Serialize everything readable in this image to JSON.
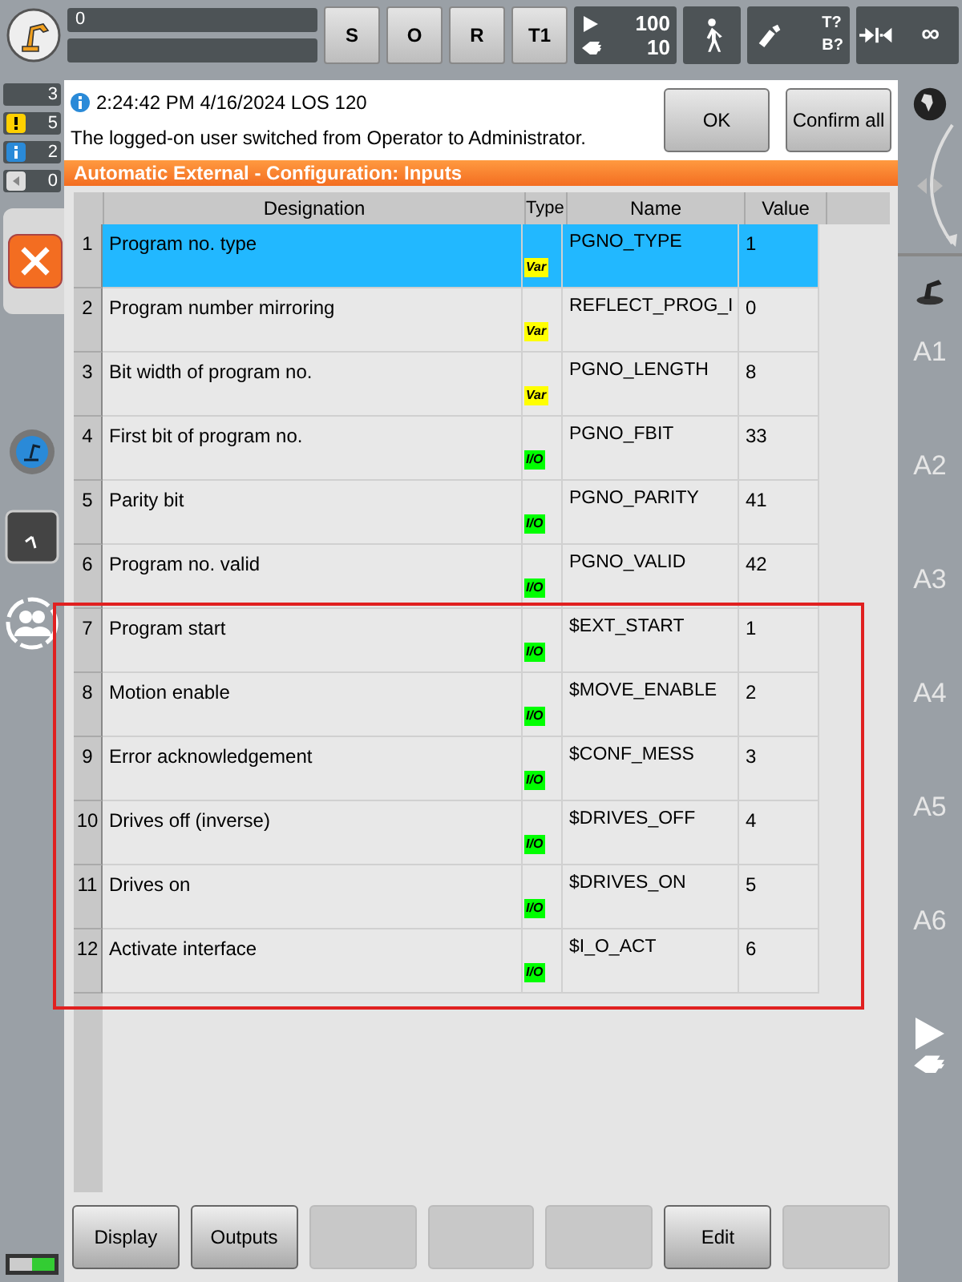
{
  "top_bar": {
    "status_field": "0",
    "mode_buttons": [
      "S",
      "O",
      "R",
      "T1"
    ],
    "override": {
      "program": "100",
      "jog": "10"
    },
    "tool_base": {
      "tool": "T?",
      "base": "B?"
    },
    "run_mode": "∞"
  },
  "left_sidebar": {
    "message_counts": [
      {
        "kind": "ack",
        "count": "3"
      },
      {
        "kind": "warning",
        "count": "5"
      },
      {
        "kind": "info",
        "count": "2"
      },
      {
        "kind": "wait",
        "count": "0"
      }
    ]
  },
  "message": {
    "header": "2:24:42 PM 4/16/2024 LOS 120",
    "text": "The logged-on user switched from Operator to Administrator.",
    "buttons": [
      "OK",
      "Confirm all"
    ]
  },
  "title": "Automatic External - Configuration: Inputs",
  "table": {
    "columns": [
      "Designation",
      "Type",
      "Name",
      "Value"
    ],
    "row_groups": [
      {
        "framed": false,
        "rows": [
          {
            "number": "1",
            "designation": "Program no. type",
            "type": "Var",
            "kind": "var",
            "name": "PGNO_TYPE",
            "value": "1",
            "selected": true
          },
          {
            "number": "2",
            "designation": "Program number mirroring",
            "type": "Var",
            "kind": "var",
            "name": "REFLECT_PROG_I",
            "value": "0",
            "selected": false
          },
          {
            "number": "3",
            "designation": "Bit width of program no.",
            "type": "Var",
            "kind": "var",
            "name": "PGNO_LENGTH",
            "value": "8",
            "selected": false
          },
          {
            "number": "4",
            "designation": "First bit of program no.",
            "type": "I/O",
            "kind": "io",
            "name": "PGNO_FBIT",
            "value": "33",
            "selected": false
          },
          {
            "number": "5",
            "designation": "Parity bit",
            "type": "I/O",
            "kind": "io",
            "name": "PGNO_PARITY",
            "value": "41",
            "selected": false
          },
          {
            "number": "6",
            "designation": "Program no. valid",
            "type": "I/O",
            "kind": "io",
            "name": "PGNO_VALID",
            "value": "42",
            "selected": false
          }
        ]
      },
      {
        "framed": true,
        "rows": [
          {
            "number": "7",
            "designation": "Program start",
            "type": "I/O",
            "kind": "io",
            "name": "$EXT_START",
            "value": "1",
            "selected": false
          },
          {
            "number": "8",
            "designation": "Motion enable",
            "type": "I/O",
            "kind": "io",
            "name": "$MOVE_ENABLE",
            "value": "2",
            "selected": false
          },
          {
            "number": "9",
            "designation": "Error acknowledgement",
            "type": "I/O",
            "kind": "io",
            "name": "$CONF_MESS",
            "value": "3",
            "selected": false
          },
          {
            "number": "10",
            "designation": "Drives off (inverse)",
            "type": "I/O",
            "kind": "io",
            "name": "$DRIVES_OFF",
            "value": "4",
            "selected": false
          },
          {
            "number": "11",
            "designation": "Drives on",
            "type": "I/O",
            "kind": "io",
            "name": "$DRIVES_ON",
            "value": "5",
            "selected": false
          },
          {
            "number": "12",
            "designation": "Activate interface",
            "type": "I/O",
            "kind": "io",
            "name": "$I_O_ACT",
            "value": "6",
            "selected": false
          }
        ]
      }
    ]
  },
  "right_sidebar": {
    "axes": [
      "A1",
      "A2",
      "A3",
      "A4",
      "A5",
      "A6"
    ]
  },
  "softkeys": [
    {
      "label": "Display",
      "enabled": true
    },
    {
      "label": "Outputs",
      "enabled": true
    },
    {
      "enabled": false
    },
    {
      "enabled": false
    },
    {
      "enabled": false
    },
    {
      "label": "Edit",
      "enabled": true
    },
    {
      "enabled": false
    }
  ]
}
